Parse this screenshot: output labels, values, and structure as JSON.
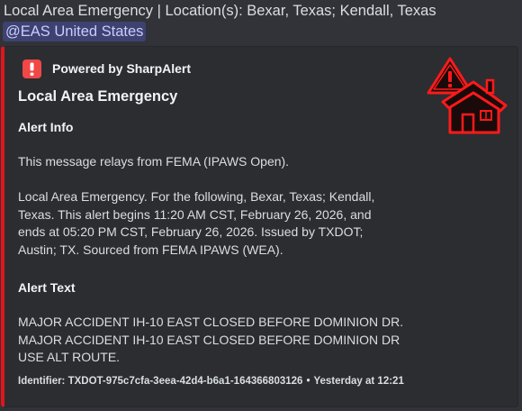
{
  "message": {
    "text": "Local Area Emergency | Location(s): Bexar, Texas; Kendall, Texas",
    "mention": "@EAS United States"
  },
  "embed": {
    "accent_color": "#e3141c",
    "author": {
      "icon": "alert-exclamation-icon",
      "name": "Powered by SharpAlert"
    },
    "thumbnail": "house-warning-icon",
    "title": "Local Area Emergency",
    "fields": {
      "info": {
        "name": "Alert Info",
        "lines": [
          "This message relays from FEMA (IPAWS Open).",
          "",
          "Local Area Emergency. For the following, Bexar, Texas; Kendall,",
          "Texas. This alert begins 11:20 AM CST, February 26, 2026, and",
          "ends at 05:20 PM CST, February 26, 2026. Issued by TXDOT;",
          "Austin; TX. Sourced from FEMA IPAWS (WEA)."
        ]
      },
      "text": {
        "name": "Alert Text",
        "lines": [
          "MAJOR ACCIDENT IH-10 EAST CLOSED BEFORE DOMINION DR.",
          "MAJOR ACCIDENT IH-10 EAST CLOSED BEFORE DOMINION DR",
          "USE ALT ROUTE."
        ]
      }
    },
    "footer": {
      "identifier": "Identifier: TXDOT-975c7cfa-3eea-42d4-b6a1-164366803126",
      "separator": "•",
      "timestamp": "Yesterday at 12:21"
    }
  }
}
